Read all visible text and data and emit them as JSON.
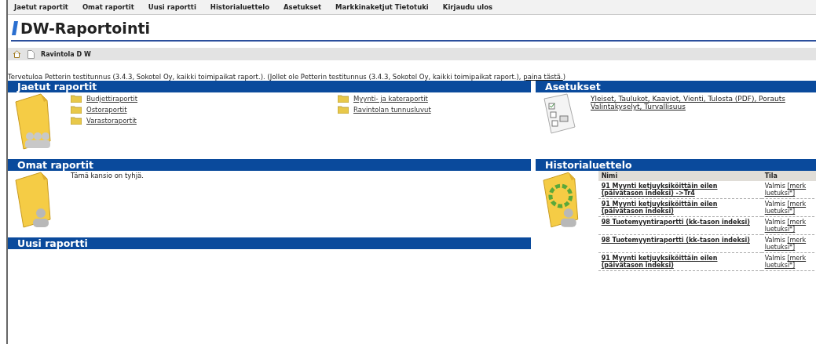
{
  "nav": [
    "Jaetut raportit",
    "Omat raportit",
    "Uusi raportti",
    "Historialuettelo",
    "Asetukset",
    "Markkinaketjut Tietotuki",
    "Kirjaudu ulos"
  ],
  "app_title": "DW-Raportointi",
  "breadcrumb": "Ravintola D W",
  "welcome": {
    "text": "Tervetuloa Petterin testitunnus (3.4.3, Sokotel Oy, kaikki toimipaikat raport.). (Jollet ole Petterin testitunnus (3.4.3, Sokotel Oy, kaikki toimipaikat raport.),",
    "link": "paina tästä.",
    "tail": ")"
  },
  "shared_reports": {
    "title": "Jaetut raportit",
    "folders": [
      {
        "label": "Budjettiraportit"
      },
      {
        "label": "Myynti- ja kateraportit"
      },
      {
        "label": "Ostoraportit"
      },
      {
        "label": "Ravintolan tunnusluvut"
      },
      {
        "label": "Varastoraportit"
      }
    ]
  },
  "own_reports": {
    "title": "Omat raportit",
    "empty_text": "Tämä kansio on tyhjä."
  },
  "new_report": {
    "title": "Uusi raportti"
  },
  "settings": {
    "title": "Asetukset",
    "lines": [
      "Yleiset, Taulukot, Kaaviot, Vienti, Tulosta (PDF), Porauts",
      "Valintakyselyt, Turvallisuus"
    ]
  },
  "history": {
    "title": "Historialuettelo",
    "columns": [
      "Nimi",
      "Tila"
    ],
    "rows": [
      {
        "name": "91 Myynti ketjuyksiköittäin eilen (päivätason indeksi) ->Tr4",
        "status": "Valmis",
        "link": [
          "[merk",
          "luetuksi*]"
        ]
      },
      {
        "name": "91 Myynti ketjuyksiköittäin eilen (päivätason indeksi)",
        "status": "Valmis",
        "link": [
          "[merk",
          "luetuksi*]"
        ]
      },
      {
        "name": "98 Tuotemyyntiraportti (kk-tason indeksi)",
        "status": "Valmis",
        "link": [
          "[merk",
          "luetuksi*]"
        ]
      },
      {
        "name": "98 Tuotemyyntiraportti (kk-tason indeksi)",
        "status": "Valmis",
        "link": [
          "[merk",
          "luetuksi*]"
        ]
      },
      {
        "name": "91 Myynti ketjuyksiköittäin eilen (päivätason indeksi)",
        "status": "Valmis",
        "link": [
          "[merk",
          "luetuksi*]"
        ]
      }
    ]
  }
}
